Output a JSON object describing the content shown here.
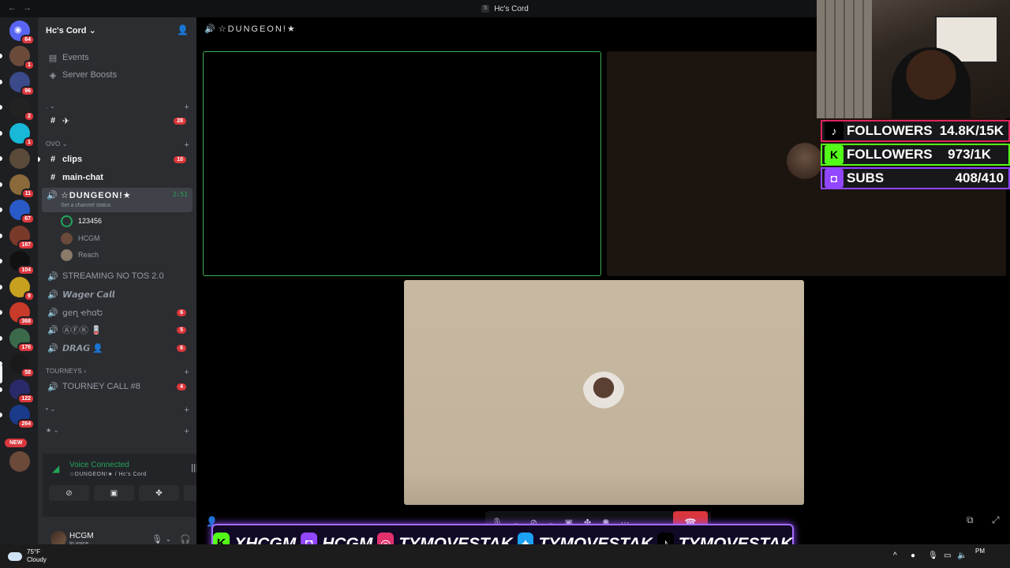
{
  "window": {
    "title": "Hc's Cord",
    "app_mark": "S"
  },
  "server_rail": {
    "home_badge": "64",
    "servers": [
      {
        "badge": "1"
      },
      {
        "badge": "96"
      },
      {
        "badge": "2"
      },
      {
        "badge": "1"
      },
      {
        "badge": ""
      },
      {
        "badge": "11"
      },
      {
        "badge": "67"
      },
      {
        "badge": "187"
      },
      {
        "badge": "104"
      },
      {
        "badge": "9"
      },
      {
        "badge": "368"
      },
      {
        "badge": "176"
      },
      {
        "badge": "58"
      },
      {
        "badge": "122"
      },
      {
        "badge": "264"
      }
    ],
    "new_label": "NEW"
  },
  "sidebar": {
    "guild_name": "Hc's Cord",
    "events_label": "Events",
    "boosts_label": "Server Boosts",
    "cat_dot": ".",
    "plane_channel": "✈",
    "plane_badge": "28",
    "cat_ovo": "OVO",
    "clips": "clips",
    "clips_badge": "10",
    "main_chat": "main-chat",
    "dungeon": "☆DUNGEON!★",
    "dungeon_status": "Set a channel status",
    "dungeon_time": "2:51",
    "voice_users": [
      "123456",
      "HCGM",
      "Reach"
    ],
    "streaming": "STREAMING NO TOS 2.0",
    "wager": "𝙒𝙖𝙜𝙚𝙧 𝘾𝙖𝙡𝙡",
    "gen_chat": "ցеղ ҽհɑԵ",
    "gen_badge": "6",
    "afk": "ⒶⒻⓀ 🪫",
    "afk_badge": "5",
    "drag": "𝘿𝙍𝘼𝙂 👤",
    "drag_badge": "6",
    "cat_tourneys": "TOURNEYS",
    "tourney_call": "TOURNEY CALL #8",
    "tourney_badge": "4",
    "cat_dot2": "•",
    "cat_star": "★"
  },
  "voice_panel": {
    "status": "Voice Connected",
    "location": "☆DUNGEON!★ / Hc's Cord"
  },
  "user": {
    "name": "HCGM",
    "status": "In voice"
  },
  "main": {
    "channel_title": "☆DUNGEON!★"
  },
  "overlay": {
    "rows": [
      {
        "label": "FOLLOWERS",
        "value": "14.8K/15K",
        "logo": "♪"
      },
      {
        "label": "FOLLOWERS",
        "value": "973/1K",
        "logo": "K"
      },
      {
        "label": "SUBS",
        "value": "408/410",
        "logo": "◘"
      }
    ],
    "banner": [
      "XHCGM",
      "HCGM",
      "TYMOVESTAK",
      "TYMOVESTAK",
      "TYMOVESTAK"
    ]
  },
  "taskbar": {
    "temp": "75°F",
    "condition": "Cloudy",
    "clock_time": "PM"
  },
  "colors": {
    "accent_green": "#23a55a",
    "badge_red": "#da373c",
    "kick": "#53fc18",
    "twitch": "#9146ff",
    "tiktok": "#e0245e"
  }
}
